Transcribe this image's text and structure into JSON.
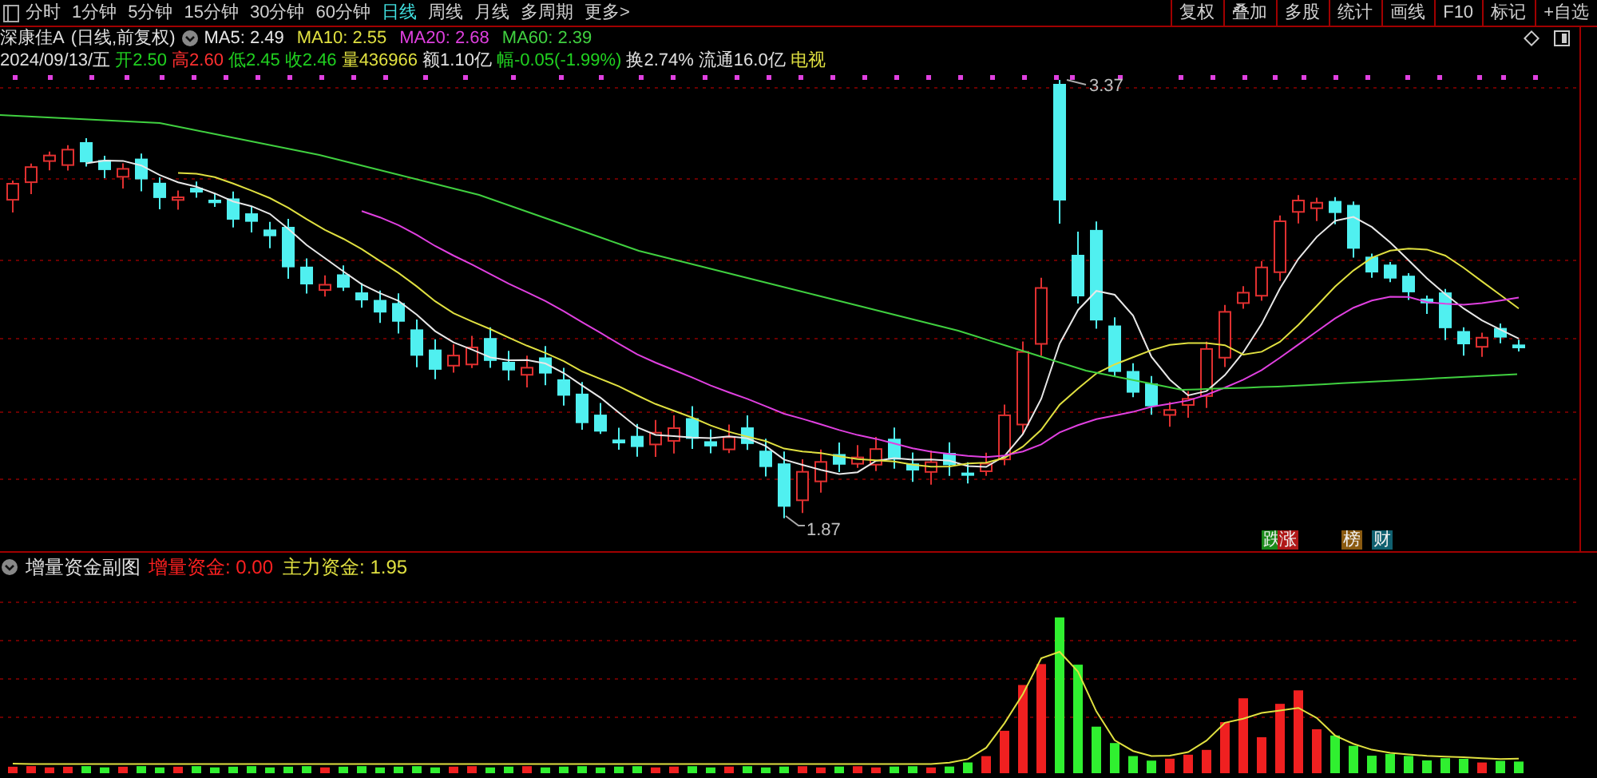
{
  "toolbar": {
    "period_tabs": [
      {
        "label": "分时",
        "selected": false
      },
      {
        "label": "1分钟",
        "selected": false
      },
      {
        "label": "5分钟",
        "selected": false
      },
      {
        "label": "15分钟",
        "selected": false
      },
      {
        "label": "30分钟",
        "selected": false
      },
      {
        "label": "60分钟",
        "selected": false
      },
      {
        "label": "日线",
        "selected": true
      },
      {
        "label": "周线",
        "selected": false
      },
      {
        "label": "月线",
        "selected": false
      },
      {
        "label": "多周期",
        "selected": false
      },
      {
        "label": "更多>",
        "selected": false
      }
    ],
    "actions": [
      "复权",
      "叠加",
      "多股",
      "统计",
      "画线",
      "F10",
      "标记",
      "+自选"
    ]
  },
  "quote": {
    "name": "深康佳A",
    "mode": "(日线,前复权)",
    "ma": [
      {
        "text": "MA5: 2.49",
        "color": "#e8e8e8"
      },
      {
        "text": "MA10: 2.55",
        "color": "#e0e040"
      },
      {
        "text": "MA20: 2.68",
        "color": "#e040e0"
      },
      {
        "text": "MA60: 2.39",
        "color": "#40d040"
      }
    ],
    "fields": [
      {
        "text": "2024/09/13/五",
        "color": "#e0e0e0"
      },
      {
        "text": "开2.50",
        "color": "#20d020"
      },
      {
        "text": "高2.60",
        "color": "#ff3030"
      },
      {
        "text": "低2.45",
        "color": "#20d020"
      },
      {
        "text": "收2.46",
        "color": "#20d020"
      },
      {
        "text": "量436966",
        "color": "#e0e040"
      },
      {
        "text": "额1.10亿",
        "color": "#e0e0e0"
      },
      {
        "text": "幅-0.05(-1.99%)",
        "color": "#20d020"
      },
      {
        "text": "换2.74%",
        "color": "#e0e0e0"
      },
      {
        "text": "流通16.0亿",
        "color": "#e0e0e0"
      },
      {
        "text": "电视",
        "color": "#e0e040"
      }
    ]
  },
  "chart": {
    "high_label": "3.37",
    "low_label": "1.87",
    "markers": [
      {
        "text": "跌",
        "color": "#1a8a1a"
      },
      {
        "text": "涨",
        "color": "#b01818"
      },
      {
        "text": "榜",
        "color": "#8a5a10"
      },
      {
        "text": "财",
        "color": "#106070"
      }
    ]
  },
  "subchart": {
    "title": "增量资金副图",
    "items": [
      {
        "text": "增量资金: 0.00",
        "color": "#ff2020"
      },
      {
        "text": "主力资金: 1.95",
        "color": "#e0e040"
      }
    ]
  }
}
